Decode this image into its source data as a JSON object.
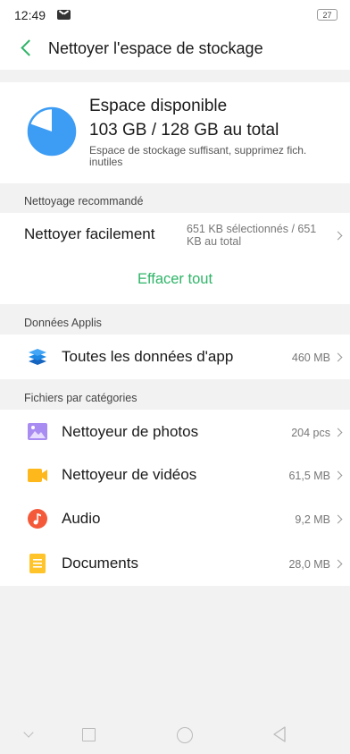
{
  "status_bar": {
    "time": "12:49",
    "battery": "27"
  },
  "header": {
    "title": "Nettoyer l'espace de stockage"
  },
  "storage": {
    "title": "Espace disponible",
    "value": "103 GB / 128 GB au total",
    "description": "Espace de stockage suffisant, supprimez fich. inutiles",
    "used_fraction": 0.195
  },
  "recommended": {
    "section_label": "Nettoyage recommandé",
    "easy_clean_label": "Nettoyer facilement",
    "easy_clean_meta": "651 KB sélectionnés / 651 KB au total",
    "clear_all_label": "Effacer tout"
  },
  "app_data": {
    "section_label": "Données Applis",
    "all_app_data_label": "Toutes les données d'app",
    "all_app_data_size": "460 MB"
  },
  "categories": {
    "section_label": "Fichiers par catégories",
    "items": [
      {
        "label": "Nettoyeur de photos",
        "value": "204 pcs",
        "icon": "photos-icon",
        "color": "#a98cf2"
      },
      {
        "label": "Nettoyeur de vidéos",
        "value": "61,5 MB",
        "icon": "videos-icon",
        "color": "#ffb81c"
      },
      {
        "label": "Audio",
        "value": "9,2 MB",
        "icon": "audio-icon",
        "color": "#f45a3a"
      },
      {
        "label": "Documents",
        "value": "28,0 MB",
        "icon": "documents-icon",
        "color": "#ffc42a"
      }
    ]
  },
  "colors": {
    "accent": "#2fb468",
    "pie_blue": "#3d9cf4",
    "app_data_icon": "#1e88e5"
  }
}
